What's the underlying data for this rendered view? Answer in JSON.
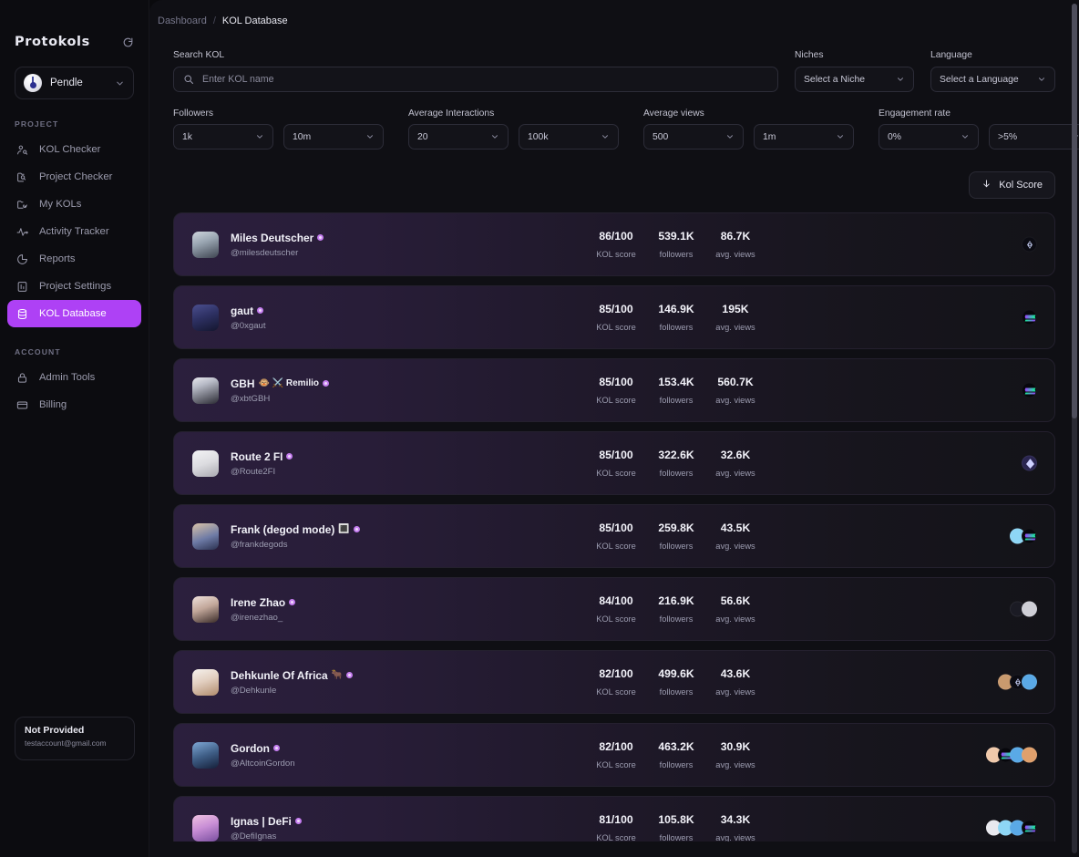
{
  "sidebar": {
    "brand": "Protokols",
    "refresh_icon": "refresh-icon",
    "project": {
      "name": "Pendle",
      "chevron_icon": "chevron-down-icon"
    },
    "section_project_label": "PROJECT",
    "section_account_label": "ACCOUNT",
    "project_items": [
      {
        "label": "KOL Checker",
        "icon": "user-search-icon",
        "active": false
      },
      {
        "label": "Project Checker",
        "icon": "folder-search-icon",
        "active": false
      },
      {
        "label": "My KOLs",
        "icon": "folder-check-icon",
        "active": false
      },
      {
        "label": "Activity Tracker",
        "icon": "activity-pulse-icon",
        "active": false
      },
      {
        "label": "Reports",
        "icon": "pie-chart-icon",
        "active": false
      },
      {
        "label": "Project Settings",
        "icon": "sliders-icon",
        "active": false
      },
      {
        "label": "KOL Database",
        "icon": "database-icon",
        "active": true
      }
    ],
    "account_items": [
      {
        "label": "Admin Tools",
        "icon": "lock-icon"
      },
      {
        "label": "Billing",
        "icon": "credit-card-icon"
      }
    ],
    "user": {
      "name": "Not Provided",
      "email": "testaccount@gmail.com"
    }
  },
  "breadcrumb": {
    "parent": "Dashboard",
    "separator": "/",
    "current": "KOL Database"
  },
  "filters": {
    "search": {
      "label": "Search KOL",
      "placeholder": "Enter KOL name",
      "value": "",
      "icon": "search-icon"
    },
    "niches": {
      "label": "Niches",
      "value": "Select a Niche"
    },
    "language": {
      "label": "Language",
      "value": "Select a Language"
    },
    "followers": {
      "label": "Followers",
      "min": "1k",
      "max": "10m"
    },
    "average_interactions": {
      "label": "Average Interactions",
      "min": "20",
      "max": "100k"
    },
    "average_views": {
      "label": "Average views",
      "min": "500",
      "max": "1m"
    },
    "engagement_rate": {
      "label": "Engagement rate",
      "min": "0%",
      "max": ">5%"
    }
  },
  "sort": {
    "label": "Kol Score",
    "icon": "arrow-down-icon"
  },
  "stat_labels": {
    "score": "KOL score",
    "followers": "followers",
    "views": "avg. views"
  },
  "kols": [
    {
      "name": "Miles Deutscher",
      "emoji": "",
      "verified": true,
      "handle": "@milesdeutscher",
      "score": "86/100",
      "followers": "539.1K",
      "views": "86.7K",
      "badges": [
        "b-sui"
      ]
    },
    {
      "name": "gaut",
      "emoji": "",
      "verified": true,
      "handle": "@0xgaut",
      "score": "85/100",
      "followers": "146.9K",
      "views": "195K",
      "badges": [
        "b-sol"
      ]
    },
    {
      "name": "GBH",
      "emoji": "🐵 ⚔️ Remilio",
      "verified": true,
      "handle": "@xbtGBH",
      "score": "85/100",
      "followers": "153.4K",
      "views": "560.7K",
      "badges": [
        "b-sol"
      ]
    },
    {
      "name": "Route 2 FI",
      "emoji": "",
      "verified": true,
      "handle": "@Route2FI",
      "score": "85/100",
      "followers": "322.6K",
      "views": "32.6K",
      "badges": [
        "b-eth"
      ]
    },
    {
      "name": "Frank (degod mode)",
      "emoji": "🔳",
      "verified": true,
      "handle": "@frankdegods",
      "score": "85/100",
      "followers": "259.8K",
      "views": "43.5K",
      "badges": [
        "b-lblue",
        "b-sol"
      ]
    },
    {
      "name": "Irene Zhao",
      "emoji": "",
      "verified": true,
      "handle": "@irenezhao_",
      "score": "84/100",
      "followers": "216.9K",
      "views": "56.6K",
      "badges": [
        "b-dark",
        "b-grey"
      ]
    },
    {
      "name": "Dehkunle Of Africa",
      "emoji": "🐂",
      "verified": true,
      "handle": "@Dehkunle",
      "score": "82/100",
      "followers": "499.6K",
      "views": "43.6K",
      "badges": [
        "b-tan",
        "b-sui",
        "b-blue"
      ]
    },
    {
      "name": "Gordon",
      "emoji": "",
      "verified": true,
      "handle": "@AltcoinGordon",
      "score": "82/100",
      "followers": "463.2K",
      "views": "30.9K",
      "badges": [
        "b-peach",
        "b-sol",
        "b-blue",
        "b-orange"
      ]
    },
    {
      "name": "Ignas | DeFi",
      "emoji": "",
      "verified": true,
      "handle": "@DefiIgnas",
      "score": "81/100",
      "followers": "105.8K",
      "views": "34.3K",
      "badges": [
        "b-white",
        "b-lblue",
        "b-blue",
        "b-sol"
      ]
    }
  ]
}
